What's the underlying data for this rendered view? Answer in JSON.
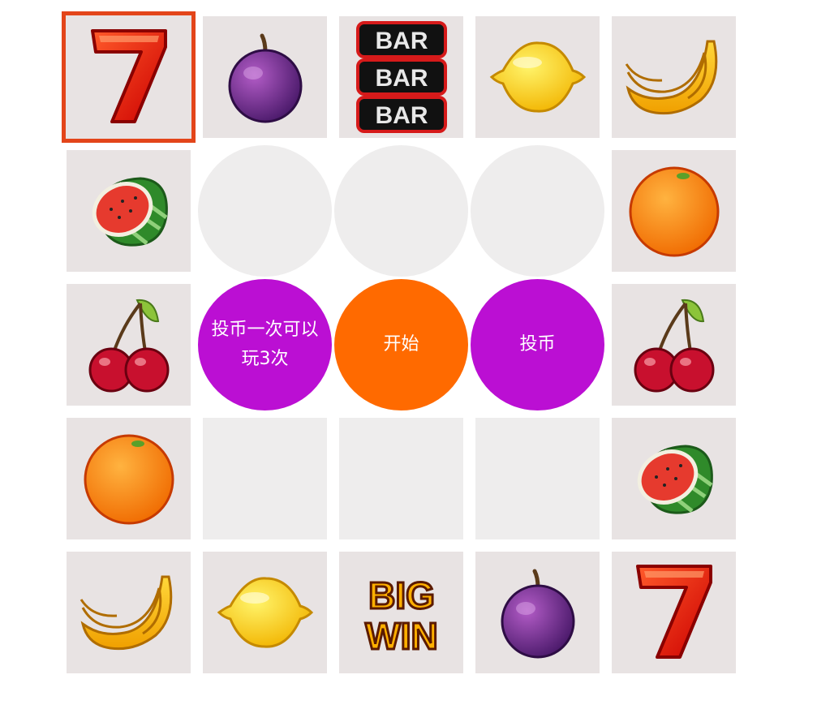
{
  "colors": {
    "cell_bg": "#e8e3e3",
    "highlight_border": "#e3451a",
    "disc_bg": "#eeeded",
    "coin_button": "#bb0fd3",
    "start_button": "#ff6a00",
    "button_text": "#ffffff"
  },
  "board": {
    "highlighted_cell": "seven",
    "top_row": [
      "seven-icon",
      "plum-icon",
      "triple-bar-icon",
      "lemon-icon",
      "banana-icon"
    ],
    "left_column": [
      "watermelon-icon",
      "cherry-icon",
      "orange-icon"
    ],
    "right_column": [
      "orange-icon",
      "cherry-icon",
      "watermelon-icon"
    ],
    "bottom_row": [
      "banana-icon",
      "lemon-icon",
      "big-win-icon",
      "plum-icon",
      "seven-icon"
    ],
    "bar_text": "BAR",
    "big_win_line1": "BIG",
    "big_win_line2": "WIN"
  },
  "controls": {
    "info_label": "投币一次可以玩3次",
    "start_label": "开始",
    "coin_label": "投币"
  }
}
